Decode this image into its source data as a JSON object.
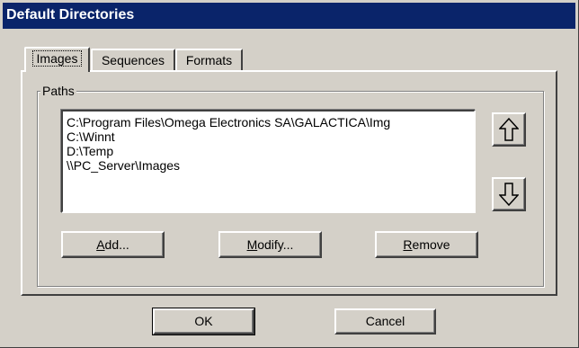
{
  "window": {
    "title": "Default Directories"
  },
  "tabs": [
    {
      "label": "Images",
      "active": true
    },
    {
      "label": "Sequences",
      "active": false
    },
    {
      "label": "Formats",
      "active": false
    }
  ],
  "paths": {
    "group_label": "Paths",
    "items": [
      "C:\\Program Files\\Omega Electronics SA\\GALACTICA\\Img",
      "C:\\Winnt",
      "D:\\Temp",
      "\\\\PC_Server\\Images"
    ],
    "up_icon": "arrow-up-outline-icon",
    "down_icon": "arrow-down-outline-icon",
    "buttons": {
      "add": {
        "mnemonic": "A",
        "rest": "dd..."
      },
      "modify": {
        "mnemonic": "M",
        "rest": "odify..."
      },
      "remove": {
        "mnemonic": "R",
        "rest": "emove"
      }
    }
  },
  "footer": {
    "ok_label": "OK",
    "cancel_label": "Cancel"
  }
}
